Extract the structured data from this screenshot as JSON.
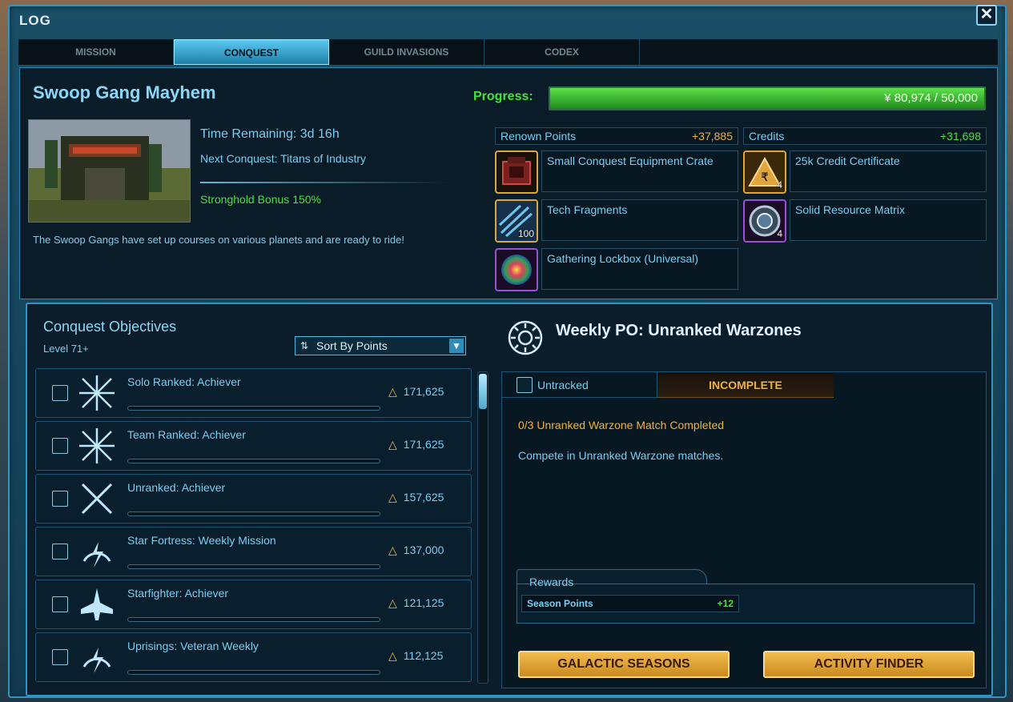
{
  "window": {
    "title": "LOG",
    "close_label": "✕"
  },
  "tabs": [
    {
      "label": "MISSION",
      "active": false
    },
    {
      "label": "CONQUEST",
      "active": true
    },
    {
      "label": "GUILD INVASIONS",
      "active": false
    },
    {
      "label": "CODEX",
      "active": false
    }
  ],
  "conquest": {
    "title": "Swoop Gang Mayhem",
    "time_remaining": "Time Remaining: 3d 16h",
    "next_conquest": "Next Conquest: Titans of Industry",
    "stronghold_bonus": "Stronghold Bonus 150%",
    "description": "The Swoop Gangs have set up courses on various planets and are ready to ride!",
    "progress_label": "Progress:",
    "progress_text": "80,974 / 50,000",
    "progress_fraction": 1.0,
    "progress_icon": "conquest-points-icon"
  },
  "stats": {
    "renown_label": "Renown Points",
    "renown_value": "+37,885",
    "credits_label": "Credits",
    "credits_value": "+31,698"
  },
  "rewards": [
    {
      "name": "Small Conquest Equipment Crate",
      "qty": "",
      "icon": "crate-icon",
      "rarity": "gold"
    },
    {
      "name": "25k Credit Certificate",
      "qty": "4",
      "icon": "credit-certificate-icon",
      "rarity": "gold"
    },
    {
      "name": "Tech Fragments",
      "qty": "100",
      "icon": "tech-fragments-icon",
      "rarity": "gold"
    },
    {
      "name": "Solid Resource Matrix",
      "qty": "4",
      "icon": "resource-matrix-icon",
      "rarity": "purple"
    },
    {
      "name": "Gathering Lockbox (Universal)",
      "qty": "",
      "icon": "lockbox-icon",
      "rarity": "purple"
    }
  ],
  "objectives": {
    "title": "Conquest Objectives",
    "level": "Level 71+",
    "sort_label": "Sort By Points",
    "items": [
      {
        "name": "Solo Ranked: Achiever",
        "points": "171,625",
        "icon": "crossed-sabers-icon"
      },
      {
        "name": "Team Ranked: Achiever",
        "points": "171,625",
        "icon": "crossed-sabers-icon"
      },
      {
        "name": "Unranked: Achiever",
        "points": "157,625",
        "icon": "crossed-sabers-icon"
      },
      {
        "name": "Star Fortress: Weekly Mission",
        "points": "137,000",
        "icon": "lightning-gauge-icon"
      },
      {
        "name": "Starfighter: Achiever",
        "points": "121,125",
        "icon": "starfighter-icon"
      },
      {
        "name": "Uprisings: Veteran Weekly",
        "points": "112,125",
        "icon": "lightning-gauge-icon"
      }
    ]
  },
  "detail": {
    "title": "Weekly PO: Unranked Warzones",
    "untracked_label": "Untracked",
    "status": "INCOMPLETE",
    "progress": "0/3 Unranked Warzone Match Completed",
    "description": "Compete in Unranked Warzone matches.",
    "rewards_label": "Rewards",
    "season_points_label": "Season Points",
    "season_points_value": "+12",
    "button_1": "GALACTIC SEASONS",
    "button_2": "ACTIVITY FINDER"
  }
}
